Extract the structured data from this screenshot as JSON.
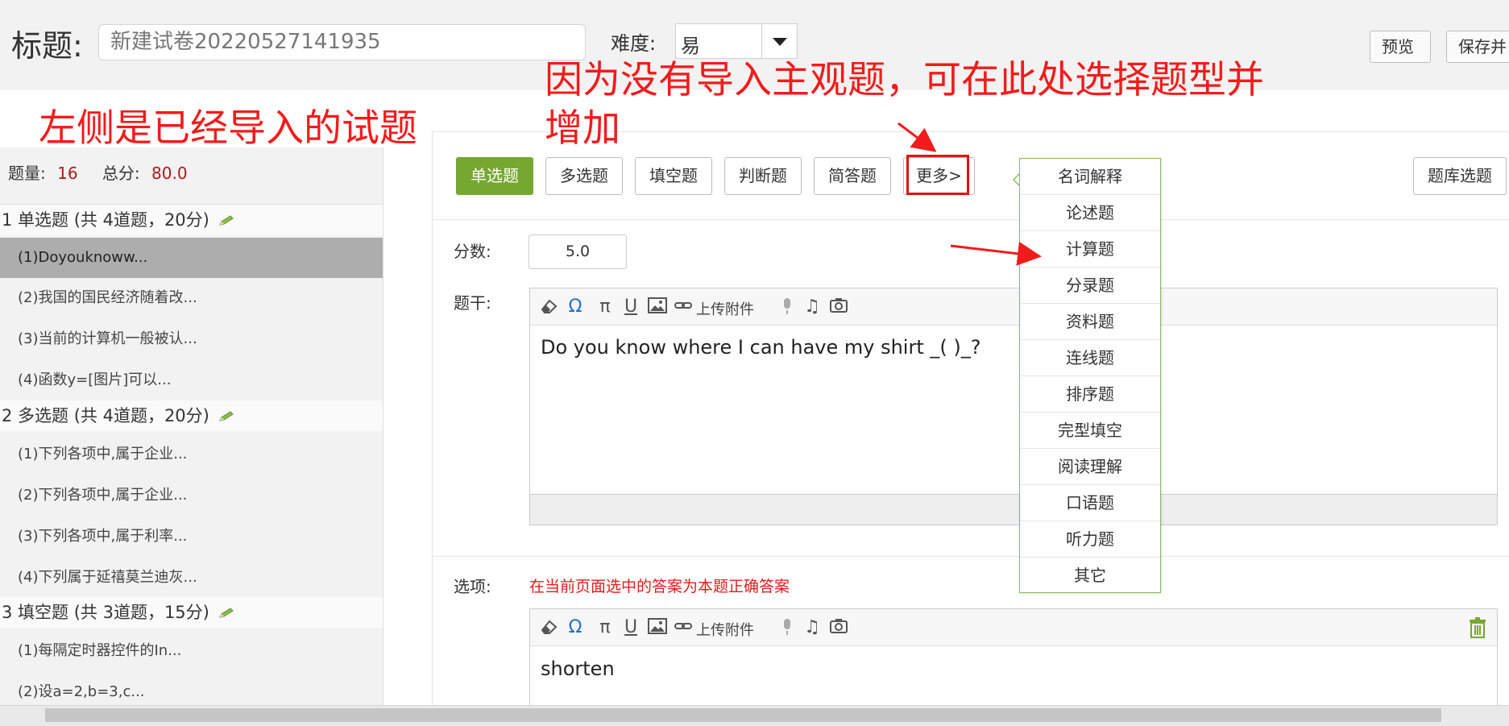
{
  "header": {
    "title_label": "标题:",
    "title_value": "新建试卷20220527141935",
    "difficulty_label": "难度:",
    "difficulty_value": "易",
    "preview_label": "预览",
    "save_label": "保存并"
  },
  "sidebar": {
    "count_label": "题量:",
    "count_value": "16",
    "total_label": "总分:",
    "total_value": "80.0",
    "sections": [
      {
        "title": "1 单选题 (共 4道题，20分)",
        "items": [
          "(1)Doyouknoww...",
          "(2)我国的国民经济随着改...",
          "(3)当前的计算机一般被认...",
          "(4)函数y=[图片]可以..."
        ]
      },
      {
        "title": "2 多选题 (共 4道题，20分)",
        "items": [
          "(1)下列各项中,属于企业...",
          "(2)下列各项中,属于企业...",
          "(3)下列各项中,属于利率...",
          "(4)下列属于延禧莫兰迪灰..."
        ]
      },
      {
        "title": "3 填空题 (共 3道题，15分)",
        "items": [
          "(1)每隔定时器控件的In...",
          "(2)设a=2,b=3,c..."
        ]
      }
    ]
  },
  "tabs": [
    "单选题",
    "多选题",
    "填空题",
    "判断题",
    "简答题",
    "更多>"
  ],
  "bank_button": "题库选题",
  "form": {
    "score_label": "分数:",
    "score_value": "5.0",
    "stem_label": "题干:",
    "stem_text": "Do you know where I can have my shirt _( )_?",
    "options_label": "选项:",
    "options_note": "在当前页面选中的答案为本题正确答案",
    "option_text": "shorten",
    "upload_label": "上传附件"
  },
  "more_menu": [
    "名词解释",
    "论述题",
    "计算题",
    "分录题",
    "资料题",
    "连线题",
    "排序题",
    "完型填空",
    "阅读理解",
    "口语题",
    "听力题",
    "其它"
  ],
  "annotations": {
    "left_note": "左侧是已经导入的试题",
    "top_note_line1": "因为没有导入主观题，可在此处选择题型并",
    "top_note_line2": "增加"
  },
  "colors": {
    "accent_green": "#76a730",
    "annotation_red": "#f21b1b",
    "score_red": "#b11818"
  }
}
